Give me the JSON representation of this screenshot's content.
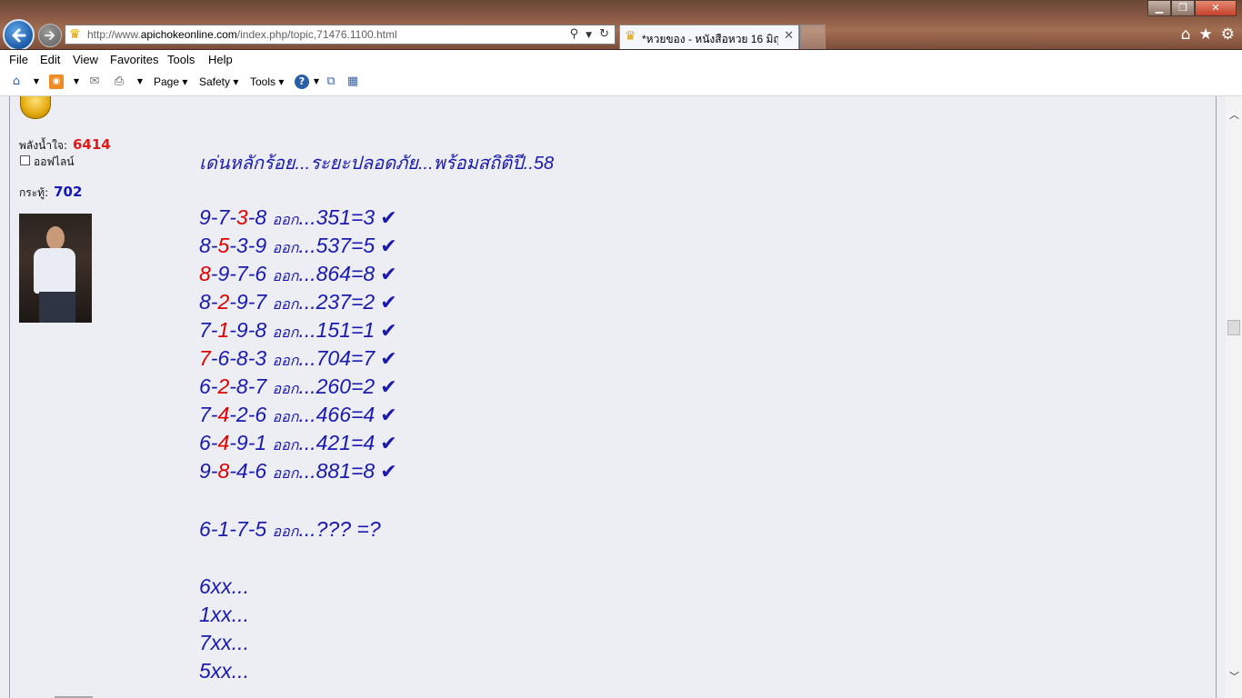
{
  "browser": {
    "url_prefix": "http://www.",
    "url_domain": "apichokeonline.com",
    "url_path": "/index.php/topic,71476.1100.html",
    "tab_title": "*หวยของ - หนังสือหวย 16 มิถุ...",
    "tab_close": "✕",
    "win_min": "▁",
    "win_max": "❐",
    "win_close": "✕"
  },
  "menu": {
    "file": "File",
    "edit": "Edit",
    "view": "View",
    "favorites": "Favorites",
    "tools": "Tools",
    "help": "Help"
  },
  "commandbar": {
    "page": "Page ▾",
    "safety": "Safety ▾",
    "tools": "Tools ▾"
  },
  "profile": {
    "power_label": "พลังน้ำใจ:",
    "power_value": "6414",
    "status": "ออฟไลน์",
    "posts_label": "กระทู้:",
    "posts_value": "702"
  },
  "post": {
    "headline": "เด่นหลักร้อย...ระยะปลอดภัย...พร้อมสถิติปี..58",
    "ook": "ออก",
    "check": "✔",
    "rows": [
      {
        "pre": "9-7-",
        "hi": "3",
        "post": "-8",
        "result": "...351=3"
      },
      {
        "pre": "8-",
        "hi": "5",
        "post": "-3-9",
        "result": "...537=5"
      },
      {
        "pre": "",
        "hi": "8",
        "post": "-9-7-6",
        "result": "...864=8"
      },
      {
        "pre": "8-",
        "hi": "2",
        "post": "-9-7",
        "result": "...237=2"
      },
      {
        "pre": "7-",
        "hi": "1",
        "post": "-9-8",
        "result": "...151=1"
      },
      {
        "pre": "",
        "hi": "7",
        "post": "-6-8-3",
        "result": "...704=7"
      },
      {
        "pre": "6-",
        "hi": "2",
        "post": "-8-7",
        "result": "...260=2"
      },
      {
        "pre": "7-",
        "hi": "4",
        "post": "-2-6",
        "result": "...466=4"
      },
      {
        "pre": "6-",
        "hi": "4",
        "post": "-9-1",
        "result": "...421=4"
      },
      {
        "pre": "9-",
        "hi": "8",
        "post": "-4-6",
        "result": "...881=8"
      }
    ],
    "next_numbers": "6-1-7-5",
    "next_result": "...??? =?",
    "guesses": [
      "6xx...",
      "1xx...",
      "7xx...",
      "5xx..."
    ]
  }
}
